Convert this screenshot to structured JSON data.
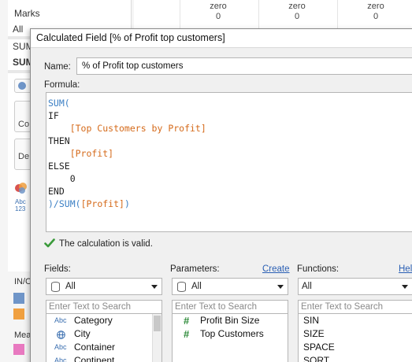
{
  "background": {
    "marks_title": "Marks",
    "marks_rows": [
      "All",
      "SUM",
      "SUM"
    ],
    "shelf_labels": [
      "Co",
      "De"
    ],
    "abc_label": "Abc",
    "abc_num": "123",
    "in_label": "IN/O",
    "mea_label": "Mea",
    "columns": [
      {
        "label": "zero",
        "value": "0"
      },
      {
        "label": "zero",
        "value": "0"
      },
      {
        "label": "zero",
        "value": "0"
      }
    ],
    "pill_colors": [
      "#6f95c8",
      "#f0a040",
      "#e879c0"
    ]
  },
  "dialog": {
    "title": "Calculated Field [% of Profit top customers]",
    "name_label": "Name:",
    "name_value": "% of Profit top customers",
    "formula_label": "Formula:",
    "code": [
      [
        {
          "t": "SUM(",
          "c": "fn"
        }
      ],
      [
        {
          "t": "IF",
          "c": "kw"
        }
      ],
      [
        {
          "t": "    [Top Customers by Profit]",
          "c": "fld"
        }
      ],
      [
        {
          "t": "THEN",
          "c": "kw"
        }
      ],
      [
        {
          "t": "    [Profit]",
          "c": "fld"
        }
      ],
      [
        {
          "t": "ELSE",
          "c": "kw"
        }
      ],
      [
        {
          "t": "    0",
          "c": "num"
        }
      ],
      [
        {
          "t": "END",
          "c": "kw"
        }
      ],
      [
        {
          "t": ")/",
          "c": "fn"
        },
        {
          "t": "SUM(",
          "c": "fn"
        },
        {
          "t": "[Profit]",
          "c": "fld"
        },
        {
          "t": ")",
          "c": "fn"
        }
      ]
    ],
    "valid_message": "The calculation is valid.",
    "fields_label": "Fields:",
    "fields_filter": "All",
    "fields_search_placeholder": "Enter Text to Search",
    "fields_items": [
      {
        "type": "Abc",
        "label": "Category"
      },
      {
        "type": "globe",
        "label": "City"
      },
      {
        "type": "Abc",
        "label": "Container"
      },
      {
        "type": "Abc",
        "label": "Continent"
      }
    ],
    "params_label": "Parameters:",
    "params_link": "Create",
    "params_filter": "All",
    "params_search_placeholder": "Enter Text to Search",
    "params_items": [
      {
        "label": "Profit Bin Size"
      },
      {
        "label": "Top Customers"
      }
    ],
    "functions_label": "Functions:",
    "functions_link": "Help",
    "functions_filter": "All",
    "functions_search_placeholder": "Enter Text to Search",
    "functions_items": [
      "SIN",
      "SIZE",
      "SPACE",
      "SQRT"
    ]
  }
}
